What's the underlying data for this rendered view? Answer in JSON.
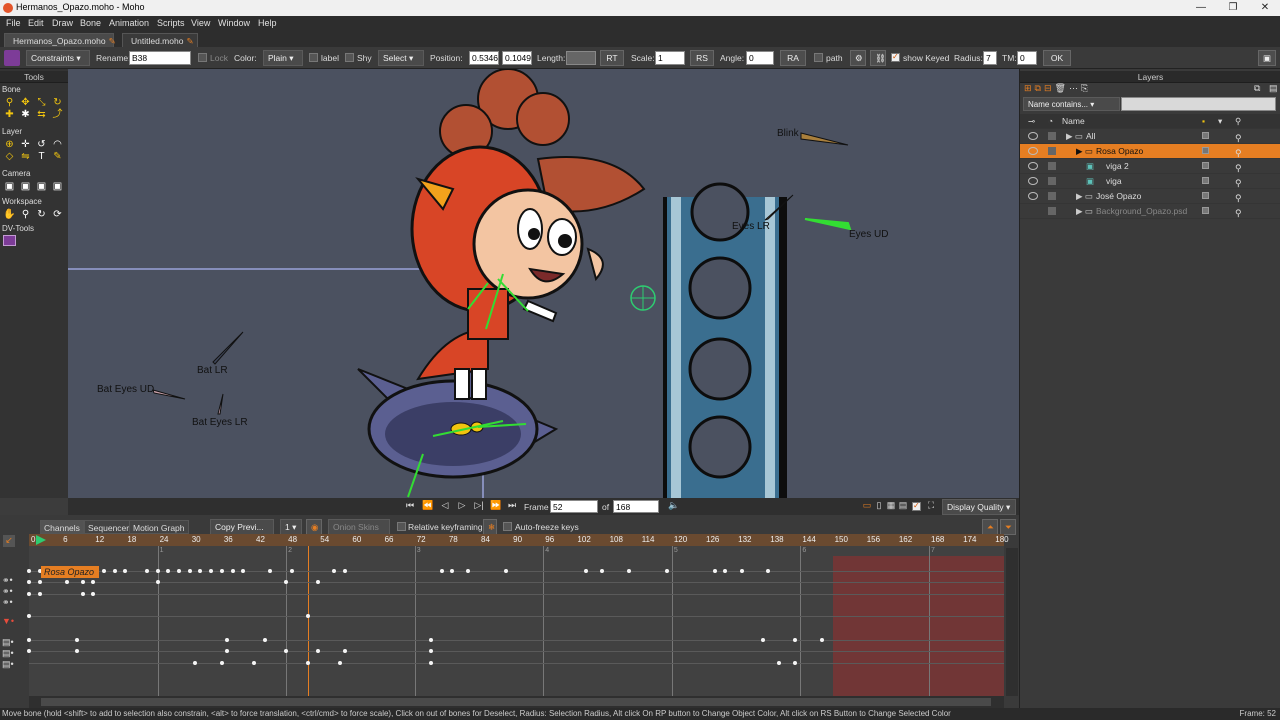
{
  "window": {
    "title": "Hermanos_Opazo.moho - Moho",
    "controls": [
      "—",
      "❐",
      "✕"
    ]
  },
  "menu": [
    "File",
    "Edit",
    "Draw",
    "Bone",
    "Animation",
    "Scripts",
    "View",
    "Window",
    "Help"
  ],
  "doc_tabs": [
    {
      "label": "Hermanos_Opazo.moho",
      "active": true
    },
    {
      "label": "Untitled.moho",
      "active": false
    }
  ],
  "tool_options": {
    "constraints": "Constraints",
    "rename_label": "Rename:",
    "rename_value": "B38",
    "lock_label": "Lock",
    "color_label": "Color:",
    "color_value": "Plain",
    "label_label": "label",
    "shy_label": "Shy",
    "select_label": "Select",
    "position_label": "Position:",
    "position_x": "0.5346",
    "position_y": "0.1049",
    "length_label": "Length:",
    "rt": "RT",
    "scale_label": "Scale:",
    "scale_value": "1",
    "rs": "RS",
    "angle_label": "Angle:",
    "angle_value": "0",
    "ra": "RA",
    "path_label": "path",
    "show_keyed_label": "show Keyed",
    "radius_label": "Radius:",
    "radius_value": "7",
    "tm_label": "TM:",
    "tm_value": "0",
    "ok": "OK"
  },
  "tools_panel": {
    "title": "Tools",
    "sections": [
      "Bone",
      "Layer",
      "Camera",
      "Workspace",
      "DV-Tools"
    ]
  },
  "canvas_labels": [
    "Blink",
    "Eyes LR",
    "Eyes UD",
    "Bat LR",
    "Bat Eyes UD",
    "Bat Eyes LR"
  ],
  "view_controls": {
    "frame_label": "Frame",
    "frame_value": "52",
    "of_label": "of",
    "total_frames": "168",
    "display_quality": "Display Quality"
  },
  "timeline": {
    "tabs": [
      "Channels",
      "Sequencer",
      "Motion Graph"
    ],
    "copy_prev": "Copy Previ...",
    "onion_count": "1",
    "onion_skins": "Onion Skins",
    "relative_keyframing": "Relative keyframing",
    "auto_freeze": "Auto-freeze keys",
    "ruler_ticks": [
      "0",
      "6",
      "12",
      "18",
      "24",
      "30",
      "36",
      "42",
      "48",
      "54",
      "60",
      "66",
      "72",
      "78",
      "84",
      "90",
      "96",
      "102",
      "108",
      "114",
      "120",
      "126",
      "132",
      "138",
      "144",
      "150",
      "156",
      "162",
      "168",
      "174",
      "180"
    ],
    "sub_ticks": [
      "1",
      "2",
      "3",
      "4",
      "5",
      "6",
      "7"
    ],
    "layer_tag": "Rosa Opazo"
  },
  "layers_panel": {
    "title": "Layers",
    "filter_label": "Name contains...",
    "name_header": "Name",
    "rows": [
      {
        "name": "All",
        "indent": 0,
        "type": "group",
        "selected": false
      },
      {
        "name": "Rosa Opazo",
        "indent": 1,
        "type": "group",
        "selected": true
      },
      {
        "name": "viga 2",
        "indent": 2,
        "type": "image",
        "selected": false
      },
      {
        "name": "viga",
        "indent": 2,
        "type": "image",
        "selected": false
      },
      {
        "name": "José Opazo",
        "indent": 1,
        "type": "group",
        "selected": false
      },
      {
        "name": "Background_Opazo.psd",
        "indent": 1,
        "type": "group",
        "selected": false
      }
    ]
  },
  "status": {
    "message": "Move bone (hold <shift> to add to selection also constrain, <alt> to force translation, <ctrl/cmd> to force scale), Click on out of bones for Deselect, Radius: Selection Radius, Alt click On RP button to Change Object Color, Alt click on RS Button to Change Selected Color",
    "frame": "Frame: 52"
  }
}
